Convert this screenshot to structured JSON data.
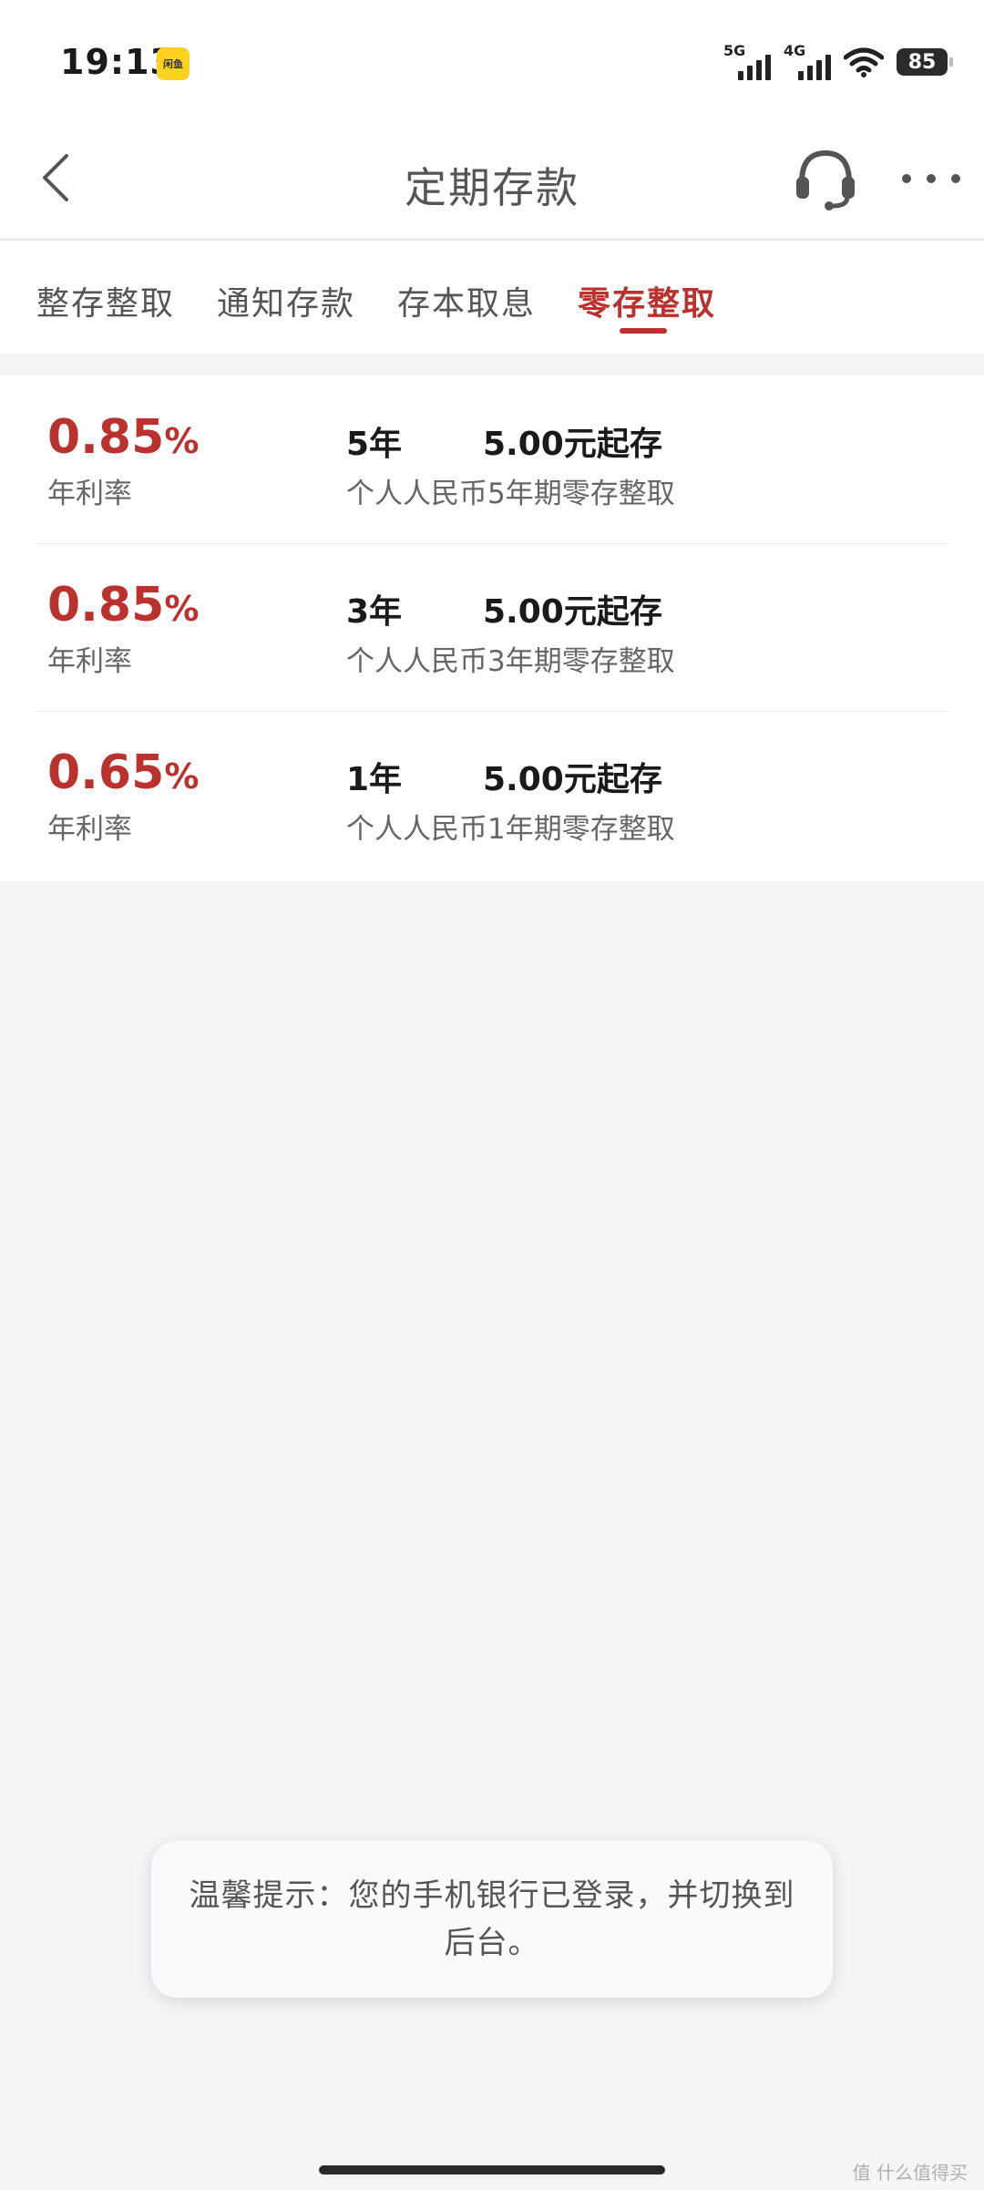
{
  "status_bar": {
    "time": "19:13",
    "app_badge": "闲鱼",
    "signal_1_label": "5G",
    "signal_2_label": "4G",
    "battery": "85"
  },
  "nav": {
    "title": "定期存款"
  },
  "tabs": [
    {
      "label": "整存整取",
      "active": false
    },
    {
      "label": "通知存款",
      "active": false
    },
    {
      "label": "存本取息",
      "active": false
    },
    {
      "label": "零存整取",
      "active": true
    }
  ],
  "rates": [
    {
      "rate": "0.85",
      "unit": "%",
      "caption": "年利率",
      "term": "5年",
      "min_amount": "5.00元起存",
      "product": "个人人民币5年期零存整取"
    },
    {
      "rate": "0.85",
      "unit": "%",
      "caption": "年利率",
      "term": "3年",
      "min_amount": "5.00元起存",
      "product": "个人人民币3年期零存整取"
    },
    {
      "rate": "0.65",
      "unit": "%",
      "caption": "年利率",
      "term": "1年",
      "min_amount": "5.00元起存",
      "product": "个人人民币1年期零存整取"
    }
  ],
  "toast": {
    "message": "温馨提示：您的手机银行已登录，并切换到后台。"
  },
  "watermark": "值 什么值得买",
  "colors": {
    "accent": "#b9322e",
    "background": "#f4f5f7"
  }
}
